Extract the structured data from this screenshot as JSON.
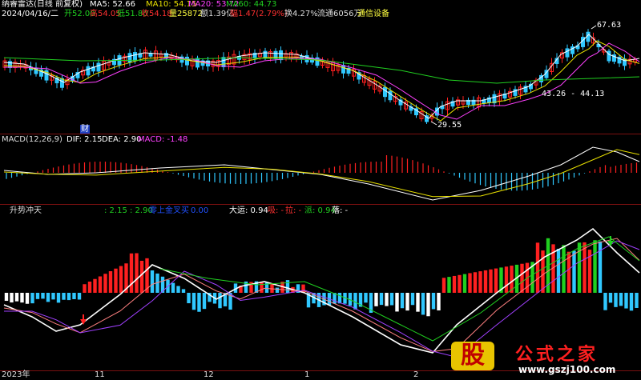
{
  "header": {
    "row1": {
      "stock": "纳睿雷达(日线 前复权)",
      "ma5_label": "MA5: 52.66",
      "ma10_label": "MA10: 54.15",
      "ma20_label": "MA20: 53.72",
      "ma60_label": "MA60: 44.73"
    },
    "row2": {
      "date": "2024/04/16/二",
      "open": "开52.00",
      "high": "高54.05",
      "low": "低51.80",
      "close": "收54.18",
      "volume": "量25872",
      "amount": "额1.39亿",
      "change": "幅1.47(2.79%)",
      "turnover": "换4.27%",
      "float": "流通6056万",
      "sector": "通信设备"
    }
  },
  "price_panel": {
    "annotations": {
      "high_value": "67.63",
      "low_value": "29.55",
      "range_value": "43.26 - 44.13",
      "finance_marker": "财"
    }
  },
  "macd_panel": {
    "title": "MACD(12,26,9)",
    "dif": "DIF: 2.15",
    "dea": "DEA: 2.90",
    "macd": "MACD: -1.48"
  },
  "indicator_panel": {
    "title": "升势冲天",
    "values": ": 2.15 : 2.90",
    "cross_label": "零上金叉买",
    "cross_value": "0.00",
    "dayun": "大运: 0.94",
    "xi": "吸: -",
    "la": "拉: -",
    "pai": "派: 0.94",
    "luo": "落: -"
  },
  "time_axis": {
    "labels": [
      "2023年",
      "11",
      "12",
      "1",
      "2"
    ]
  },
  "watermark": {
    "logo_char": "股",
    "brand": "公式之家",
    "url": "www.gszj100.com"
  },
  "colors": {
    "ma5": "#ffffff",
    "ma10": "#e8e000",
    "ma20": "#ff40ff",
    "ma60": "#20d020",
    "up": "#ff2020",
    "down": "#30c8ff",
    "panel_line": "#7a1010"
  }
}
